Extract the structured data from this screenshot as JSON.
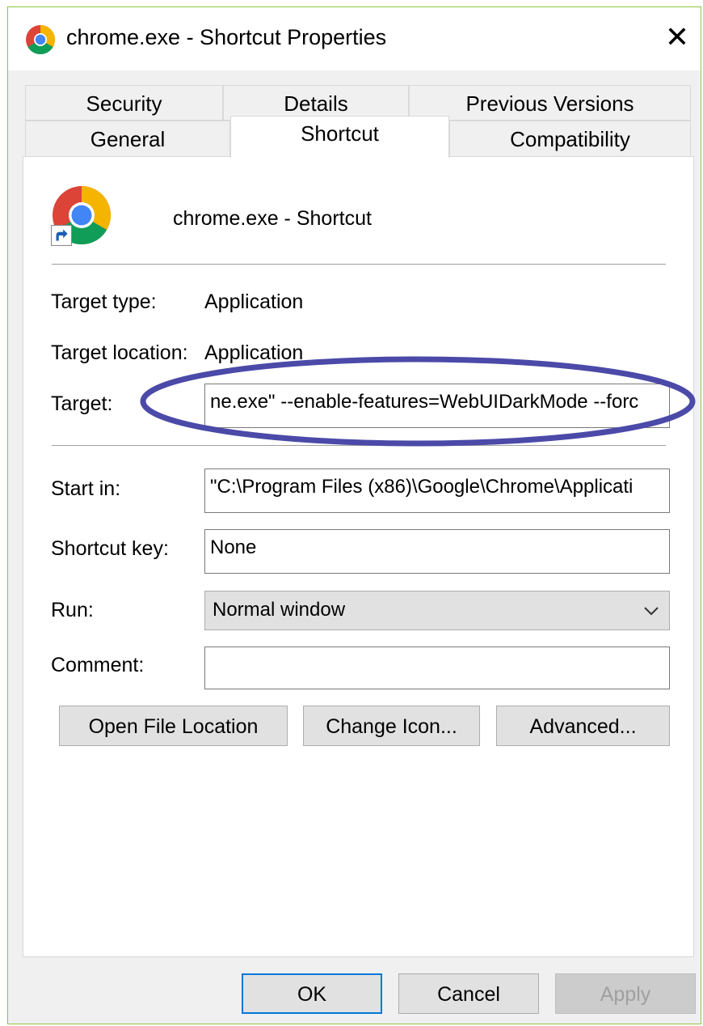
{
  "window": {
    "title": "chrome.exe - Shortcut Properties",
    "close_glyph": "✕"
  },
  "tabs": {
    "row_top": [
      "Security",
      "Details",
      "Previous Versions"
    ],
    "row_bottom": [
      "General",
      "Shortcut",
      "Compatibility"
    ],
    "active": "Shortcut"
  },
  "header": {
    "name": "chrome.exe - Shortcut"
  },
  "info": {
    "target_type_label": "Target type:",
    "target_type_value": "Application",
    "target_location_label": "Target location:",
    "target_location_value": "Application"
  },
  "fields": {
    "target_label": "Target:",
    "target_value": "ne.exe\" --enable-features=WebUIDarkMode --forc",
    "start_in_label": "Start in:",
    "start_in_value": "\"C:\\Program Files (x86)\\Google\\Chrome\\Applicati",
    "shortcut_key_label": "Shortcut key:",
    "shortcut_key_value": "None",
    "run_label": "Run:",
    "run_value": "Normal window",
    "comment_label": "Comment:",
    "comment_value": ""
  },
  "actions": {
    "open_file_location": "Open File Location",
    "change_icon": "Change Icon...",
    "advanced": "Advanced..."
  },
  "footer": {
    "ok": "OK",
    "cancel": "Cancel",
    "apply": "Apply"
  },
  "colors": {
    "highlight_oval": "#4b4aa8",
    "default_button_border": "#0078d7",
    "window_border": "#8cc63f"
  },
  "icons": [
    "chrome-icon",
    "shortcut-arrow-icon",
    "close-icon",
    "chevron-down-icon"
  ]
}
